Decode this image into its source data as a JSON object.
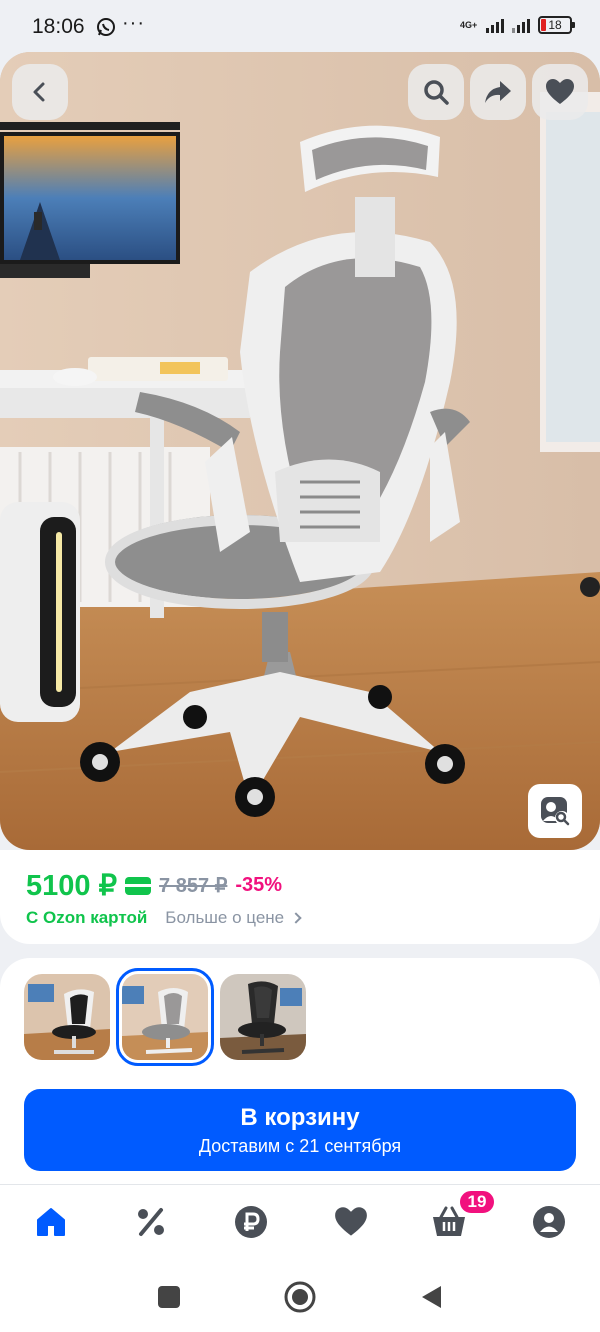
{
  "status_bar": {
    "time": "18:06",
    "extra": "···",
    "network": "4G+",
    "battery": "18"
  },
  "colors": {
    "ozon_blue": "#005bff",
    "price_green": "#10c44c",
    "discount_pink": "#f1117e",
    "muted_gray": "#8a94a3"
  },
  "toolbar": {
    "back_icon": "chevron-left-icon",
    "search_icon": "search-icon",
    "share_icon": "share-icon",
    "favorite_icon": "heart-icon",
    "similar_icon": "image-search-icon"
  },
  "price": {
    "current": "5100 ₽",
    "old": "7 857 ₽",
    "discount": "-35%",
    "ozon_card_label": "С Ozon картой",
    "more_label": "Больше о цене"
  },
  "gallery": {
    "selected_index": 1,
    "count": 3
  },
  "cart": {
    "label": "В корзину",
    "delivery": "Доставим с 21 сентября"
  },
  "tabbar": {
    "items": [
      "home-icon",
      "percent-icon",
      "ruble-icon",
      "heart-icon",
      "basket-icon",
      "profile-icon"
    ],
    "cart_badge": "19"
  },
  "system_nav": [
    "square-icon",
    "circle-icon",
    "triangle-back-icon"
  ]
}
